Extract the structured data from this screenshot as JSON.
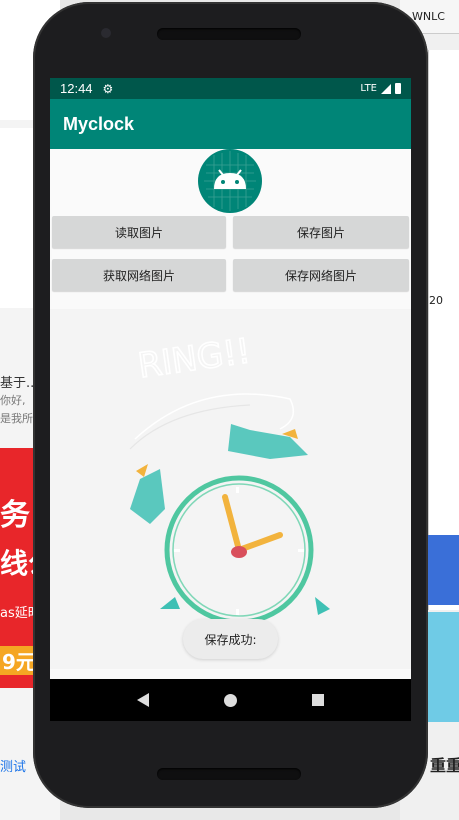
{
  "status_bar": {
    "time": "12:44",
    "network": "LTE"
  },
  "app": {
    "title": "Myclock"
  },
  "buttons": {
    "read_image": "读取图片",
    "save_image": "保存图片",
    "fetch_web_image": "获取网络图片",
    "save_web_image": "保存网络图片"
  },
  "image": {
    "caption": "RING!!"
  },
  "toast": {
    "message": "保存成功:"
  },
  "background": {
    "left_texts": [
      "基于..",
      "你好,",
      "是我所",
      "务",
      "线公",
      "as延时",
      "9元",
      "测试"
    ],
    "right_texts": [
      "WNLC",
      "20",
      "重重"
    ]
  },
  "colors": {
    "status_bar": "#00574b",
    "app_bar": "#008577",
    "accent": "#d81b60"
  }
}
